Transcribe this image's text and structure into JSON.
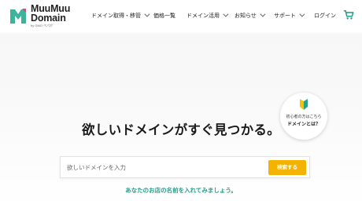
{
  "logo": {
    "line1": "MuuMuu",
    "line2": "Domain",
    "sub": "by GMO ペパボ"
  },
  "nav": {
    "items": [
      {
        "label": "ドメイン取得・移管",
        "has_dropdown": true
      },
      {
        "label": "価格一覧",
        "has_dropdown": false
      },
      {
        "label": "ドメイン活用",
        "has_dropdown": true
      },
      {
        "label": "お知らせ",
        "has_dropdown": true
      },
      {
        "label": "サポート",
        "has_dropdown": true
      },
      {
        "label": "ログイン",
        "has_dropdown": false
      }
    ],
    "cart_icon": "cart-icon"
  },
  "beginner": {
    "line1": "初心者の方はこちら",
    "line2": "ドメインとは？",
    "icon": "beginner-mark-icon"
  },
  "hero": {
    "headline": "欲しいドメインがすぐ見つかる。",
    "search_placeholder": "欲しいドメインを入力",
    "search_value": "",
    "search_button": "検索する",
    "subline": "あなたのお店の名前を入れてみましょう。"
  },
  "colors": {
    "accent_teal": "#28a08c",
    "brand_green": "#3cb49b",
    "button_yellow": "#f3b300",
    "logo_pink": "#e8467c"
  }
}
